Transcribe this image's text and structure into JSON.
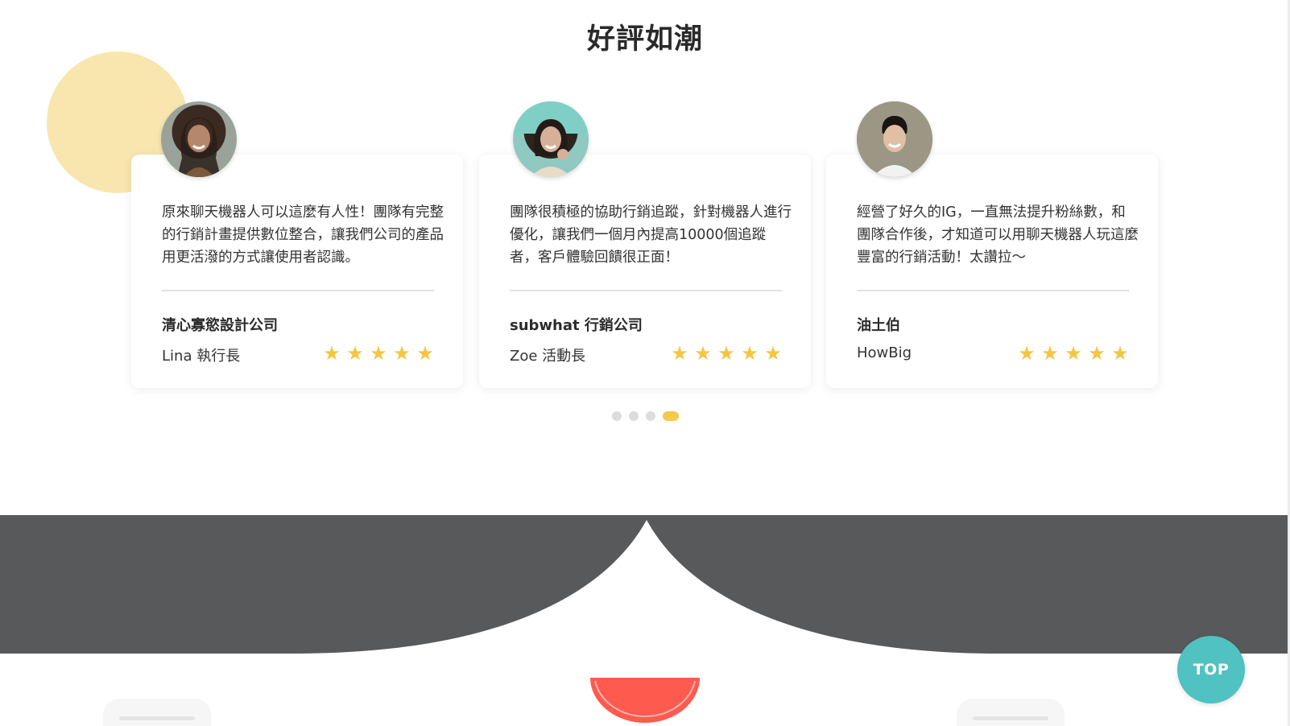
{
  "section": {
    "title": "好評如潮"
  },
  "testimonials": [
    {
      "quote": "原來聊天機器人可以這麼有人性！團隊有完整的行銷計畫提供數位整合，讓我們公司的產品用更活潑的方式讓使用者認識。",
      "company": "清心寡慾設計公司",
      "person": "Lina 執行長",
      "rating": 5
    },
    {
      "quote": "團隊很積極的協助行銷追蹤，針對機器人進行優化，讓我們一個月內提高10000個追蹤者，客戶體驗回饋很正面！",
      "company": "subwhat 行銷公司",
      "person": "Zoe 活動長",
      "rating": 5
    },
    {
      "quote": "經營了好久的IG，一直無法提升粉絲數，和團隊合作後，才知道可以用聊天機器人玩這麼豐富的行銷活動！太讚拉～",
      "company": "油土伯",
      "person": "HowBig",
      "rating": 5
    }
  ],
  "carousel": {
    "page_count": 4,
    "active_index": 3
  },
  "top_button": {
    "label": "TOP"
  },
  "colors": {
    "accent_yellow": "#f6c94a",
    "deco_yellow": "#f9e5ae",
    "dark_band": "#58595b",
    "teal": "#4fc2c1",
    "coral": "#ff5a4e",
    "star": "#f5c542"
  },
  "icons": {
    "star": "star-icon",
    "avatar": "avatar"
  }
}
